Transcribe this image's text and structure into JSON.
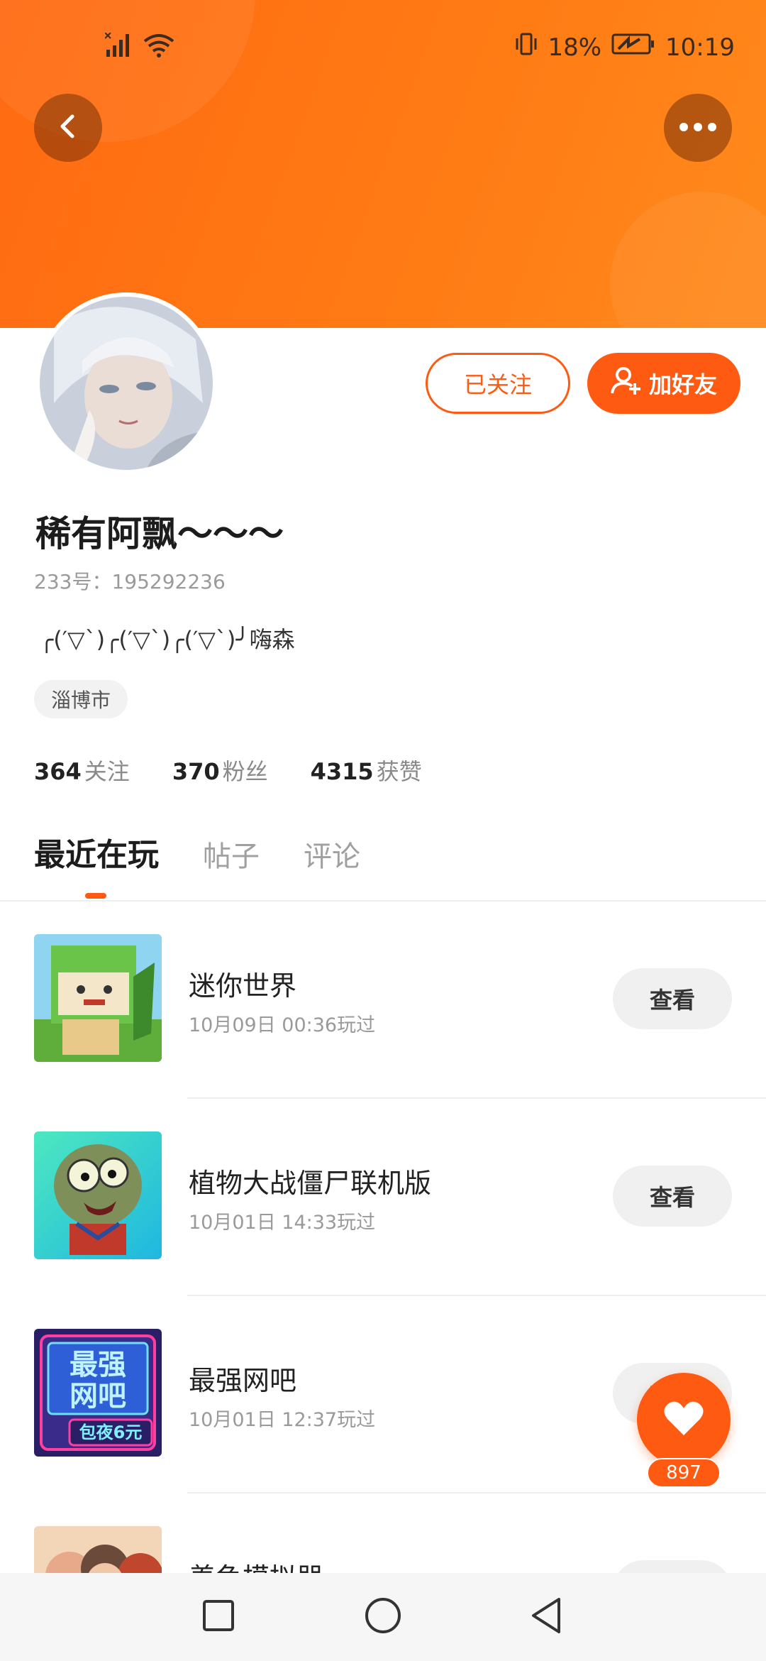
{
  "status_bar": {
    "battery_percent": "18%",
    "time": "10:19"
  },
  "profile": {
    "name": "稀有阿飘～～～",
    "uid": "233号：195292236",
    "bio": "╭(′▽`)╭(′▽`)╭(′▽`)╯嗨森",
    "location": "淄博市",
    "followed_label": "已关注",
    "add_friend_label": "加好友"
  },
  "stats": [
    {
      "value": "364",
      "label": "关注"
    },
    {
      "value": "370",
      "label": "粉丝"
    },
    {
      "value": "4315",
      "label": "获赞"
    }
  ],
  "tabs": [
    {
      "label": "最近在玩",
      "active": true
    },
    {
      "label": "帖子",
      "active": false
    },
    {
      "label": "评论",
      "active": false
    }
  ],
  "games": [
    {
      "title": "迷你世界",
      "time": "10月09日 00:36玩过",
      "button": "查看"
    },
    {
      "title": "植物大战僵尸联机版",
      "time": "10月01日 14:33玩过",
      "button": "查看"
    },
    {
      "title": "最强网吧",
      "time": "10月01日 12:37玩过",
      "button": "查看"
    },
    {
      "title": "养鱼模拟器",
      "time": "",
      "button": "查看"
    }
  ],
  "thumb_text": {
    "wangba_line1": "最强",
    "wangba_line2": "网吧",
    "wangba_tag": "包夜6元"
  },
  "like_fab": {
    "count": "897"
  },
  "colors": {
    "accent": "#ff5a12",
    "header_gradient_start": "#ff6a12",
    "header_gradient_end": "#ff8a1c"
  },
  "icons": {
    "back": "chevron-left-icon",
    "more": "more-dots-icon",
    "add_user": "add-user-icon",
    "like": "heart-icon",
    "nav_recent": "square-icon",
    "nav_home": "circle-icon",
    "nav_back": "triangle-back-icon"
  }
}
